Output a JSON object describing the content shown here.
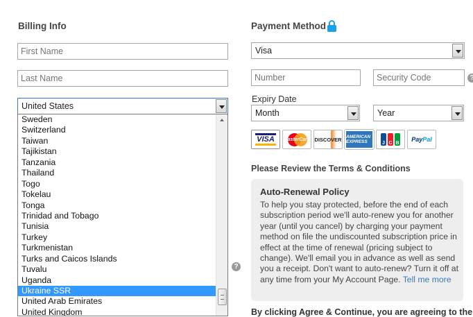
{
  "billing": {
    "heading": "Billing Info",
    "first_name_placeholder": "First Name",
    "last_name_placeholder": "Last Name",
    "country_selected": "United States",
    "country_options": [
      "Sweden",
      "Switzerland",
      "Taiwan",
      "Tajikistan",
      "Tanzania",
      "Thailand",
      "Togo",
      "Tokelau",
      "Tonga",
      "Trinidad and Tobago",
      "Tunisia",
      "Turkey",
      "Turkmenistan",
      "Turks and Caicos Islands",
      "Tuvalu",
      "Uganda",
      "Ukraine SSR",
      "United Arab Emirates",
      "United Kingdom"
    ],
    "highlighted_option": "Ukraine SSR"
  },
  "payment": {
    "heading": "Payment Method",
    "method_selected": "Visa",
    "number_placeholder": "Number",
    "security_placeholder": "Security Code",
    "expiry_label": "Expiry Date",
    "month_selected": "Month",
    "year_selected": "Year",
    "cards": {
      "visa": "VISA",
      "mastercard": "MasterCard",
      "discover": "DISCOVER",
      "amex": "AMERICAN EXPRESS",
      "jcb": [
        "J",
        "C",
        "B"
      ],
      "paypal_pay": "Pay",
      "paypal_pal": "Pal"
    },
    "accent_color": "#1ea0e6"
  },
  "terms": {
    "heading": "Please Review the Terms & Conditions",
    "policy_title": "Auto-Renewal Policy",
    "policy_text": "To help you stay protected, before the end of each subscription period we'll auto-renew you for another year (until you cancel) by charging your payment method on file the undiscounted subscription price in effect at the time of renewal (pricing subject to change). We'll email you in advance as well as send you a receipt. Don't want to auto-renew? Turn it off at any time from your My Account Page.",
    "policy_link": "Tell me more",
    "agree_text": "By clicking Agree & Continue, you are agreeing to the"
  },
  "help_glyph": "?"
}
